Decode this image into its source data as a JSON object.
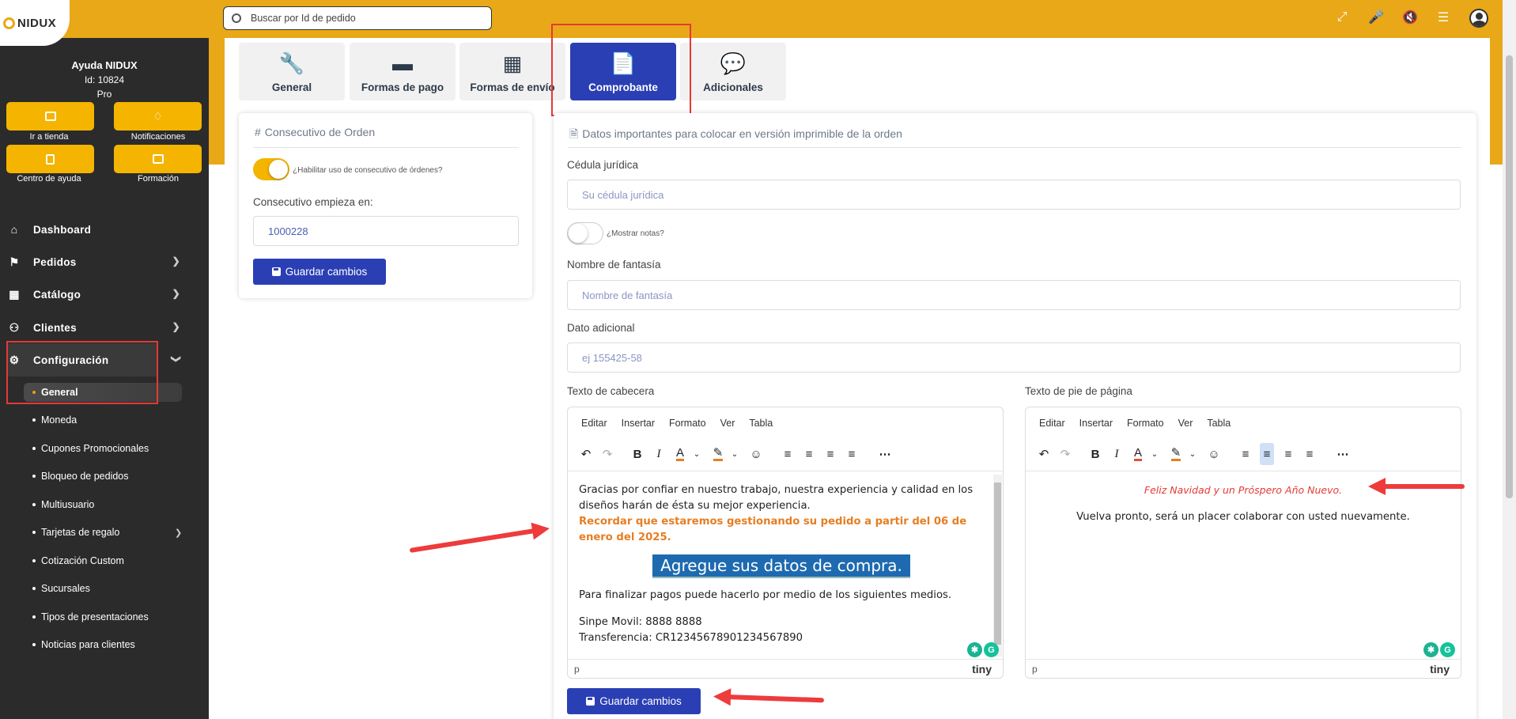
{
  "app": {
    "logo": "NIDUX"
  },
  "account": {
    "name": "Ayuda NIDUX",
    "id": "Id: 10824",
    "plan": "Pro"
  },
  "quick_actions": [
    {
      "label": "Ir a tienda",
      "icon": "store-icon"
    },
    {
      "label": "Notificaciones",
      "icon": "bell-icon"
    },
    {
      "label": "Centro de ayuda",
      "icon": "book-icon"
    },
    {
      "label": "Formación",
      "icon": "gift-icon"
    }
  ],
  "nav": {
    "items": [
      {
        "label": "Dashboard",
        "icon": "home-icon"
      },
      {
        "label": "Pedidos",
        "icon": "flag-icon"
      },
      {
        "label": "Catálogo",
        "icon": "sitemap-icon"
      },
      {
        "label": "Clientes",
        "icon": "users-icon"
      },
      {
        "label": "Configuración",
        "icon": "config-icon"
      }
    ],
    "sub_items": [
      "General",
      "Moneda",
      "Cupones Promocionales",
      "Bloqueo de pedidos",
      "Multiusuario",
      "Tarjetas de regalo",
      "Cotización Custom",
      "Sucursales",
      "Tipos de presentaciones",
      "Noticias para clientes"
    ]
  },
  "search": {
    "placeholder": "Buscar por Id de pedido"
  },
  "top_icons": [
    "compress-icon",
    "microphone-icon",
    "mute-icon",
    "sliders-icon",
    "user-avatar-icon"
  ],
  "tabs": [
    {
      "label": "General",
      "icon": "wrench-icon"
    },
    {
      "label": "Formas de pago",
      "icon": "credit-card-icon"
    },
    {
      "label": "Formas de envío",
      "icon": "dolly-icon"
    },
    {
      "label": "Comprobante",
      "icon": "file-icon"
    },
    {
      "label": "Adicionales",
      "icon": "comment-icon"
    }
  ],
  "order_panel": {
    "title": "Consecutivo de Orden",
    "toggle_label": "¿Habilitar uso de consecutivo de órdenes?",
    "field_label": "Consecutivo empieza en:",
    "field_value": "1000228",
    "save_label": "Guardar cambios"
  },
  "receipt_panel": {
    "title": "Datos importantes para colocar en versión imprimible de la orden",
    "cedula_label": "Cédula jurídica",
    "cedula_placeholder": "Su cédula jurídica",
    "notes_toggle_label": "¿Mostrar notas?",
    "fantasy_label": "Nombre de fantasía",
    "fantasy_placeholder": "Nombre de fantasía",
    "extra_label": "Dato adicional",
    "extra_placeholder": "ej 155425-58",
    "header_label": "Texto de cabecera",
    "footer_label": "Texto de pie de página",
    "save_label": "Guardar cambios"
  },
  "editor": {
    "menu": [
      "Editar",
      "Insertar",
      "Formato",
      "Ver",
      "Tabla"
    ],
    "status_path": "p",
    "brand": "tiny"
  },
  "header_text": {
    "line1": "Gracias por confiar en nuestro trabajo, nuestra experiencia y calidad en los diseños harán de ésta su mejor experiencia.",
    "highlight": "Recordar que estaremos gestionando su pedido a partir del 06 de enero del 2025.",
    "banner": "Agregue sus datos de compra.",
    "payments_intro": "Para finalizar pagos puede hacerlo por medio de los siguientes medios.",
    "sinpe": "Sinpe Movil: 8888 8888",
    "transfer": "Transferencia: CR12345678901234567890"
  },
  "footer_text": {
    "greeting": "Feliz Navidad y un Próspero Año Nuevo.",
    "line": "Vuelva pronto, será un placer colaborar con usted nuevamente."
  },
  "colors": {
    "brand_orange": "#e8a817",
    "primary_blue": "#2b3fb4",
    "highlight_orange": "#e67e22",
    "footer_red": "#e53935"
  }
}
